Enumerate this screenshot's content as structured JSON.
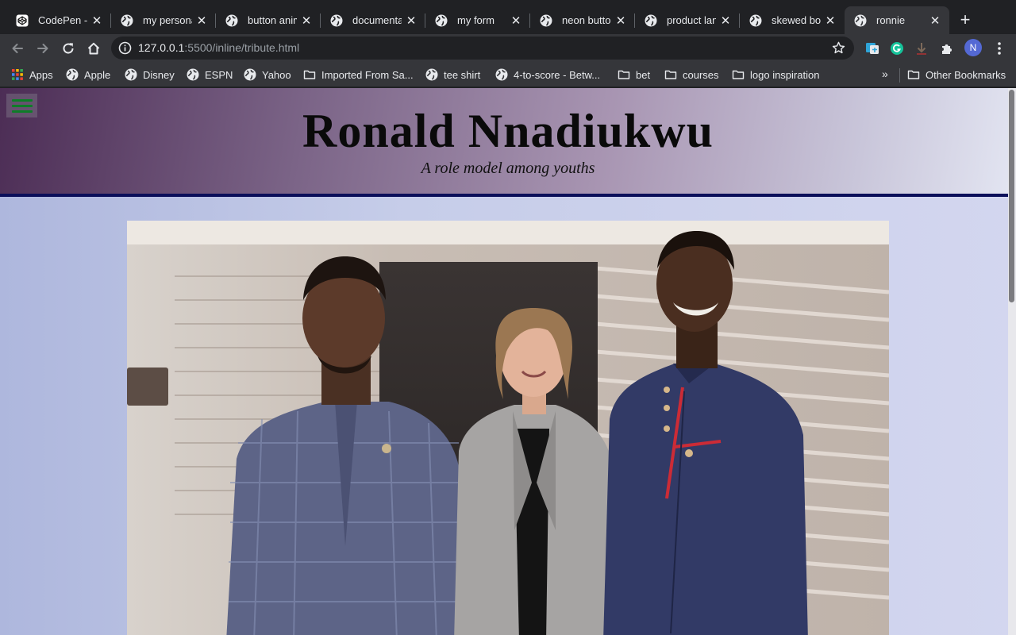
{
  "browser": {
    "tabs": [
      {
        "title": "CodePen - P",
        "favicon": "codepen-icon",
        "active": false
      },
      {
        "title": "my personal",
        "favicon": "globe-icon",
        "active": false
      },
      {
        "title": "button anim",
        "favicon": "globe-icon",
        "active": false
      },
      {
        "title": "documentat",
        "favicon": "globe-icon",
        "active": false
      },
      {
        "title": "my form",
        "favicon": "globe-icon",
        "active": false
      },
      {
        "title": "neon button",
        "favicon": "globe-icon",
        "active": false
      },
      {
        "title": "product lan",
        "favicon": "globe-icon",
        "active": false
      },
      {
        "title": "skewed bor",
        "favicon": "globe-icon",
        "active": false
      },
      {
        "title": "ronnie",
        "favicon": "globe-icon",
        "active": true
      }
    ],
    "new_tab_label": "+",
    "tab_close_glyph": "✕",
    "address": {
      "host": "127.0.0.1",
      "rest": ":5500/inline/tribute.html"
    },
    "profile_initial": "N",
    "bookmarks": [
      {
        "label": "Apps",
        "icon": "apps-grid-icon"
      },
      {
        "label": "Apple",
        "icon": "globe-icon"
      },
      {
        "label": "Disney",
        "icon": "globe-icon"
      },
      {
        "label": "ESPN",
        "icon": "globe-icon"
      },
      {
        "label": "Yahoo",
        "icon": "globe-icon"
      },
      {
        "label": "Imported From Sa...",
        "icon": "folder-icon"
      },
      {
        "label": "tee shirt",
        "icon": "globe-icon"
      },
      {
        "label": "4-to-score - Betw...",
        "icon": "globe-icon"
      },
      {
        "label": "bet",
        "icon": "folder-icon"
      },
      {
        "label": "courses",
        "icon": "folder-icon"
      },
      {
        "label": "logo inspiration",
        "icon": "folder-icon"
      }
    ],
    "bookmarks_overflow": "»",
    "other_bookmarks": "Other Bookmarks"
  },
  "page": {
    "title": "Ronald Nnadiukwu",
    "tagline": "A role model among youths",
    "menu_icon": "hamburger-menu-icon",
    "colors": {
      "menu_green": "#0e7d28",
      "hero_rule": "#0b0f5a"
    }
  }
}
